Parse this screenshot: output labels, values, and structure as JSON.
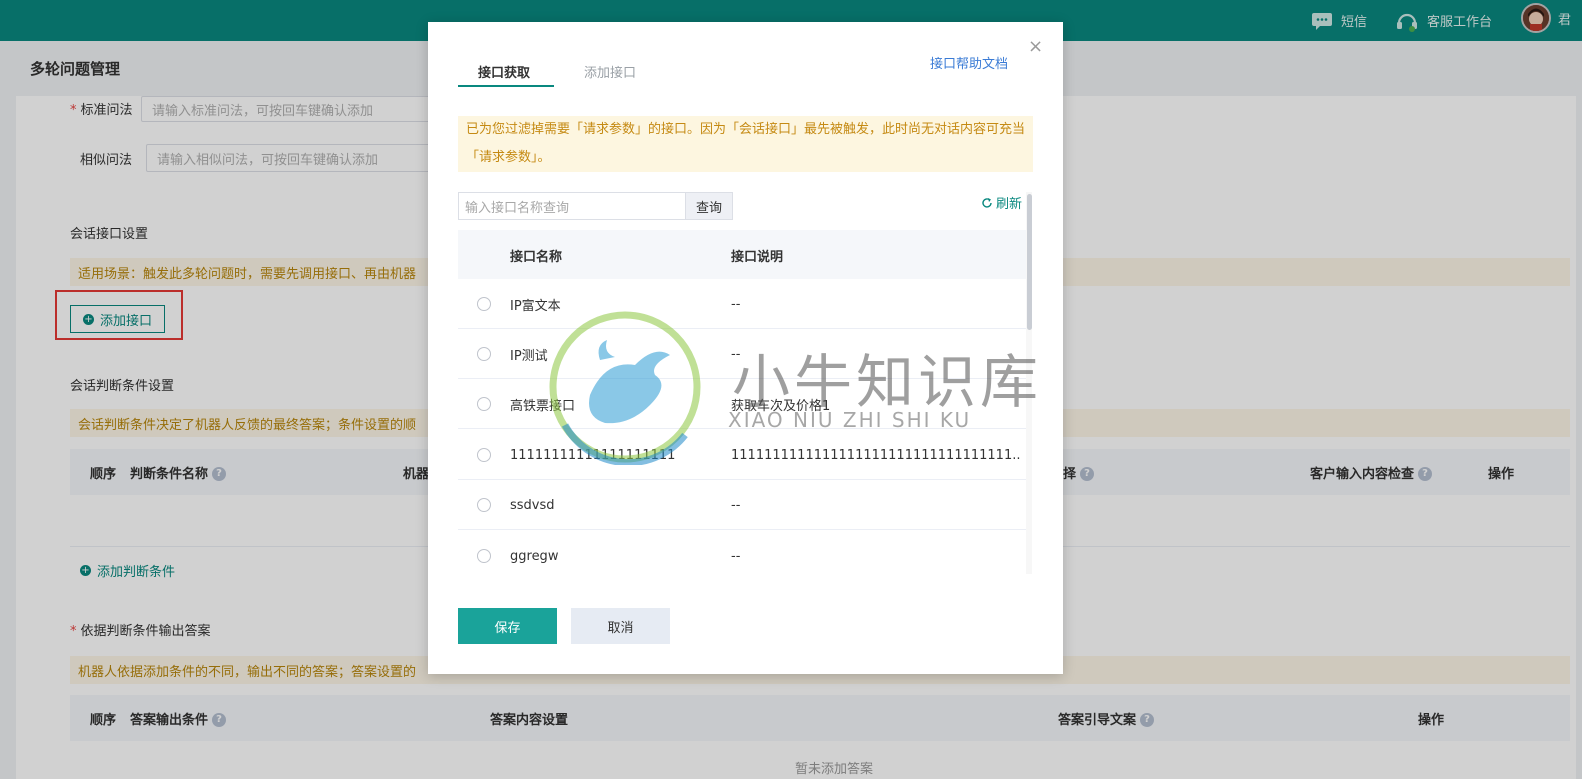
{
  "topbar": {
    "sms_label": "短信",
    "workbench_label": "客服工作台",
    "user_label": "君"
  },
  "page": {
    "title": "多轮问题管理",
    "standard_question": {
      "label": "标准问法",
      "placeholder": "请输入标准问法，可按回车键确认添加"
    },
    "similar_question": {
      "label": "相似问法",
      "placeholder": "请输入相似问法，可按回车键确认添加"
    },
    "session_api": {
      "heading": "会话接口设置",
      "notice": "适用场景：触发此多轮问题时，需要先调用接口、再由机器",
      "add_button": "添加接口"
    },
    "condition": {
      "heading": "会话判断条件设置",
      "notice": "会话判断条件决定了机器人反馈的最终答案；条件设置的顺",
      "columns": [
        "顺序",
        "判断条件名称",
        "机器",
        "择",
        "客户输入内容检查",
        "操作"
      ],
      "add_link": "添加判断条件"
    },
    "answer": {
      "heading": "依据判断条件输出答案",
      "notice": "机器人依据添加条件的不同，输出不同的答案；答案设置的",
      "columns": [
        "顺序",
        "答案输出条件",
        "答案内容设置",
        "答案引导文案",
        "操作"
      ],
      "empty": "暂未添加答案"
    }
  },
  "modal": {
    "tabs": [
      "接口获取",
      "添加接口"
    ],
    "help_link": "接口帮助文档",
    "close": "×",
    "notice": "已为您过滤掉需要「请求参数」的接口。因为「会话接口」最先被触发，此时尚无对话内容可充当「请求参数」。",
    "search_placeholder": "输入接口名称查询",
    "search_button": "查询",
    "refresh": "刷新",
    "columns": [
      "接口名称",
      "接口说明"
    ],
    "rows": [
      {
        "name": "IP富文本",
        "desc": "--"
      },
      {
        "name": "IP测试",
        "desc": "--"
      },
      {
        "name": "高铁票接口",
        "desc": "获取车次及价格1"
      },
      {
        "name": "11111111111111111111",
        "desc": "1111111111111111111111111111111111..."
      },
      {
        "name": "ssdvsd",
        "desc": "--"
      },
      {
        "name": "ggregw",
        "desc": "--"
      }
    ],
    "save": "保存",
    "cancel": "取消"
  },
  "watermark": {
    "cn": "小牛知识库",
    "en": "XIAO NIU ZHI SHI KU"
  },
  "colors": {
    "brand": "#09887f",
    "save_button": "#1aa39a",
    "notice_bg": "#fdf6e0",
    "notice_text": "#c58a13",
    "link": "#3a7bd5",
    "required": "#e64340",
    "highlight_box": "#e53935"
  }
}
